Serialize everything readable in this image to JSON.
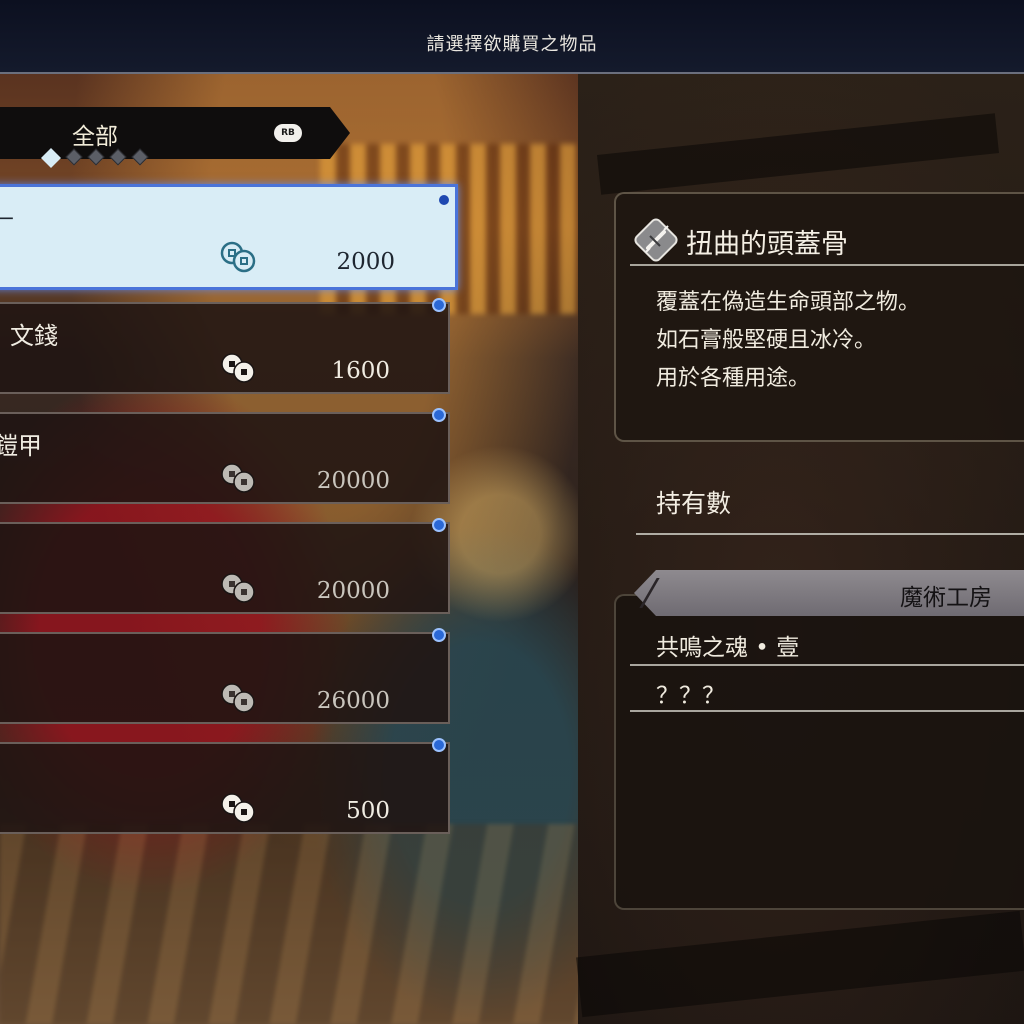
{
  "header": {
    "title": "請選擇欲購買之物品"
  },
  "category": {
    "label": "全部",
    "switch_button": "RB",
    "page_count": 5,
    "active_index": 0
  },
  "items": [
    {
      "name": "ᅳ",
      "price": "2000",
      "selected": true
    },
    {
      "name": "文錢",
      "price": "1600",
      "selected": false
    },
    {
      "name": "鎧甲",
      "price": "20000",
      "selected": false
    },
    {
      "name": "",
      "price": "20000",
      "selected": false
    },
    {
      "name": "",
      "price": "26000",
      "selected": false
    },
    {
      "name": "",
      "price": "500",
      "selected": false
    }
  ],
  "detail": {
    "icon": "broken-bone-icon",
    "title": "扭曲的頭蓋骨",
    "description": [
      "覆蓋在偽造生命頭部之物。",
      "如石膏般堅硬且冰冷。",
      "用於各種用途。"
    ],
    "owned_label": "持有數"
  },
  "workshop": {
    "title": "魔術工房",
    "entries": [
      "共鳴之魂 • 壹",
      "？？？"
    ]
  },
  "colors": {
    "selection_border": "#4a74d9",
    "selected_fill": "#d9edf6",
    "new_marker": "#2a68d6"
  }
}
